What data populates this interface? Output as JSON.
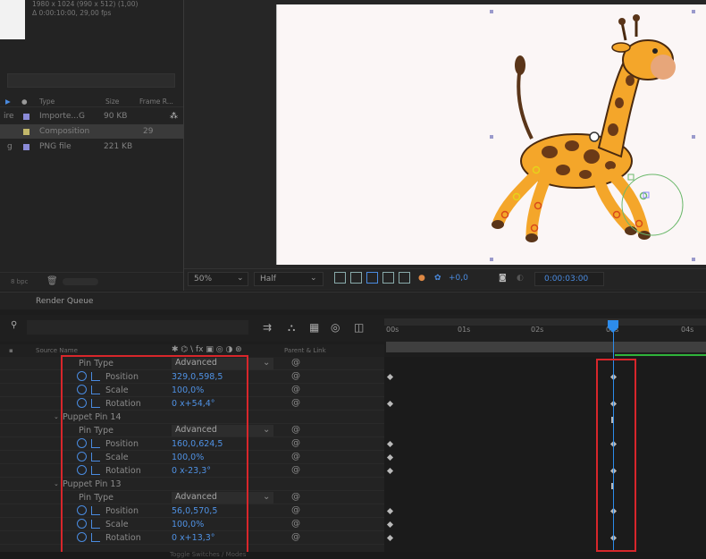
{
  "project": {
    "comp_info_line1": "1980 x 1024  (990 x 512) (1,00)",
    "comp_info_line2": "Δ 0:00:10:00, 29,00 fps",
    "columns": {
      "type": "Type",
      "size": "Size",
      "frame_rate": "Frame R..."
    },
    "items": [
      {
        "name": "ire",
        "type": "Importe...G",
        "size": "90 KB",
        "fps": "",
        "swatch": "#8b8bd8"
      },
      {
        "name": "",
        "type": "Composition",
        "size": "",
        "fps": "29",
        "swatch": "#c2b76a"
      },
      {
        "name": "g",
        "type": "PNG file",
        "size": "221 KB",
        "fps": "",
        "swatch": "#8b8bd8"
      }
    ],
    "bpc_label": "8 bpc"
  },
  "viewer": {
    "zoom": "50%",
    "resolution": "Half",
    "exposure": "+0,0",
    "timecode": "0:00:03:00"
  },
  "render_queue": {
    "label": "Render Queue"
  },
  "timeline": {
    "source_name_header": "Source Name",
    "parent_header": "Parent & Link",
    "ruler_ticks": [
      "00s",
      "01s",
      "02s",
      "03s",
      "04s"
    ],
    "rows": [
      {
        "kind": "prop",
        "name": "Pin Type",
        "value": "Advanced"
      },
      {
        "kind": "anim",
        "name": "Position",
        "value": "329,0,598,5"
      },
      {
        "kind": "anim",
        "name": "Scale",
        "value": "100,0%"
      },
      {
        "kind": "anim",
        "name": "Rotation",
        "value": "0 x+54,4°"
      },
      {
        "kind": "group",
        "name": "Puppet Pin 14"
      },
      {
        "kind": "prop",
        "name": "Pin Type",
        "value": "Advanced"
      },
      {
        "kind": "anim",
        "name": "Position",
        "value": "160,0,624,5"
      },
      {
        "kind": "anim",
        "name": "Scale",
        "value": "100,0%"
      },
      {
        "kind": "anim",
        "name": "Rotation",
        "value": "0 x-23,3°"
      },
      {
        "kind": "group",
        "name": "Puppet Pin 13"
      },
      {
        "kind": "prop",
        "name": "Pin Type",
        "value": "Advanced"
      },
      {
        "kind": "anim",
        "name": "Position",
        "value": "56,0,570,5"
      },
      {
        "kind": "anim",
        "name": "Scale",
        "value": "100,0%"
      },
      {
        "kind": "anim",
        "name": "Rotation",
        "value": "0 x+13,3°"
      }
    ],
    "footer_hint": "Toggle Switches / Modes"
  },
  "colors": {
    "accent_blue": "#2d8ceb",
    "highlight_red": "#d8262b",
    "value_blue": "#4f91e3",
    "work_area_green": "#2fb33a"
  }
}
